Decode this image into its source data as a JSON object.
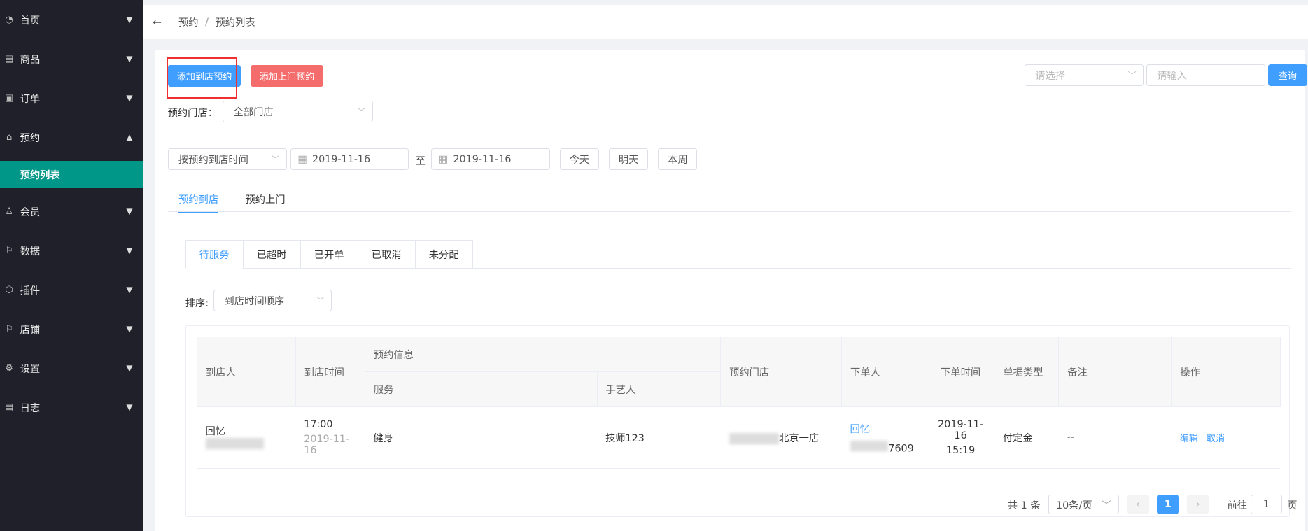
{
  "sidebar": {
    "items": [
      {
        "icon": "dashboard-icon",
        "label": "首页"
      },
      {
        "icon": "document-icon",
        "label": "商品"
      },
      {
        "icon": "clipboard-icon",
        "label": "订单"
      },
      {
        "icon": "home-icon",
        "label": "预约",
        "expanded": true
      },
      {
        "icon": "user-icon",
        "label": "会员"
      },
      {
        "icon": "flag-icon",
        "label": "数据"
      },
      {
        "icon": "cube-icon",
        "label": "插件"
      },
      {
        "icon": "flag-icon",
        "label": "店铺"
      },
      {
        "icon": "gear-icon",
        "label": "设置"
      },
      {
        "icon": "document-icon",
        "label": "日志"
      }
    ],
    "sub_active": "预约列表"
  },
  "breadcrumb": [
    "预约",
    "预约列表"
  ],
  "toolbar": {
    "add_store": "添加到店预约",
    "add_home": "添加上门预约",
    "select_placeholder": "请选择",
    "input_placeholder": "请输入",
    "query": "查询"
  },
  "filters": {
    "store_label": "预约门店：",
    "store_value": "全部门店",
    "time_type": "按预约到店时间",
    "date_from": "2019-11-16",
    "to": "至",
    "date_to": "2019-11-16",
    "today": "今天",
    "tomorrow": "明天",
    "week": "本周",
    "sort_label": "排序:",
    "sort_value": "到店时间顺序"
  },
  "tabs": [
    "预约到店",
    "预约上门"
  ],
  "status_tabs": [
    "待服务",
    "已超时",
    "已开单",
    "已取消",
    "未分配"
  ],
  "table": {
    "headers": {
      "visitor": "到店人",
      "time": "到店时间",
      "info": "预约信息",
      "service": "服务",
      "artisan": "手艺人",
      "store": "预约门店",
      "orderer": "下单人",
      "order_time": "下单时间",
      "type": "单据类型",
      "remark": "备注",
      "ops": "操作"
    },
    "rows": [
      {
        "visitor": "回忆",
        "time": "17:00",
        "date": "2019-11-16",
        "service": "健身",
        "artisan": "技师123",
        "store": "北京一店",
        "orderer": "回忆",
        "phone_tail": "7609",
        "order_date": "2019-11-16",
        "order_clock": "15:19",
        "type": "付定金",
        "remark": "--",
        "edit": "编辑",
        "cancel": "取消"
      }
    ]
  },
  "pagination": {
    "total": "共 1 条",
    "page_size": "10条/页",
    "current": "1",
    "goto": "前往",
    "goto_value": "1",
    "page": "页"
  }
}
